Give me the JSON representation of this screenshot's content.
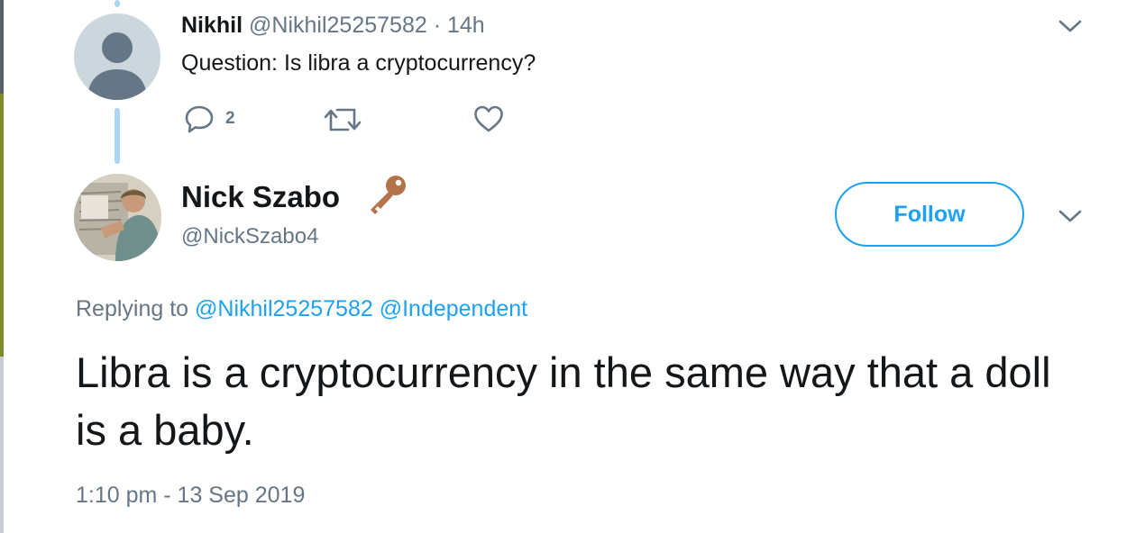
{
  "parent_tweet": {
    "display_name": "Nikhil",
    "handle": "@Nikhil25257582",
    "separator": "·",
    "time_ago": "14h",
    "text": "Question: Is libra a cryptocurrency?",
    "reply_count": "2",
    "icons": {
      "avatar": "default-avatar-silhouette",
      "reply": "reply-icon",
      "retweet": "retweet-icon",
      "like": "heart-icon",
      "menu": "chevron-down-icon"
    }
  },
  "main_tweet": {
    "display_name": "Nick Szabo",
    "name_emoji": "key-icon",
    "handle": "@NickSzabo4",
    "follow_label": "Follow",
    "replying_prefix": "Replying to",
    "replying_mentions": [
      "@Nikhil25257582",
      "@Independent"
    ],
    "text": "Libra is a cryptocurrency in the same way that a doll is a baby.",
    "timestamp": "1:10 pm - 13 Sep 2019"
  },
  "colors": {
    "accent": "#1da1f2",
    "muted_text": "#657786",
    "primary_text": "#14171a",
    "thread_line": "#a9d6f5",
    "key_emoji": "#b5734a"
  }
}
